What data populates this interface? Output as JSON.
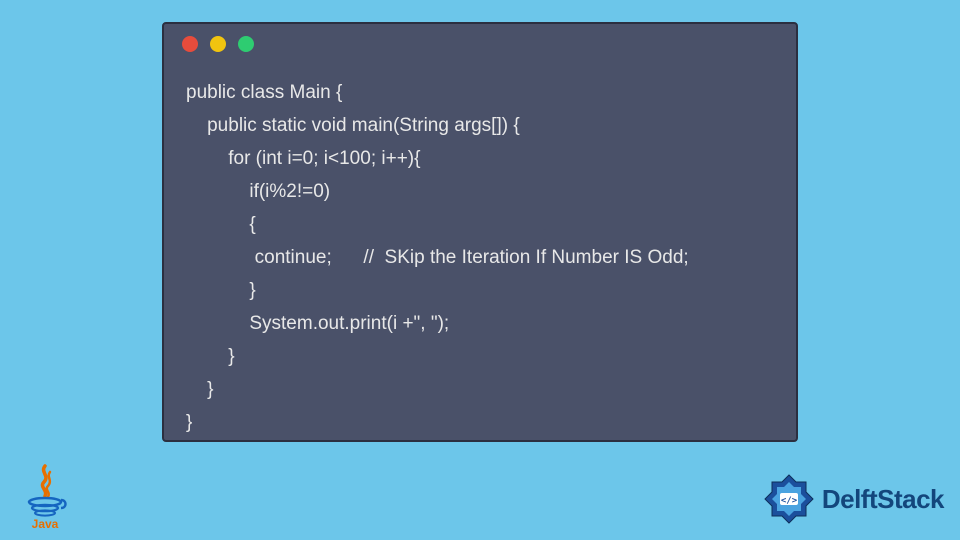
{
  "code": {
    "lines": [
      "public class Main {",
      "    public static void main(String args[]) {",
      "        for (int i=0; i<100; i++){",
      "            if(i%2!=0)",
      "            {",
      "             continue;      //  SKip the Iteration If Number IS Odd;",
      "            }",
      "            System.out.print(i +\", \");",
      "        }",
      "    }",
      "}"
    ]
  },
  "window": {
    "dots": [
      "red",
      "yellow",
      "green"
    ]
  },
  "branding": {
    "left_logo": "java",
    "right_text": "DelftStack"
  },
  "colors": {
    "background": "#6cc6ea",
    "window_bg": "#4a5169",
    "window_border": "#2b2f40",
    "code_text": "#e8e8e8",
    "brand_text": "#13467c"
  }
}
